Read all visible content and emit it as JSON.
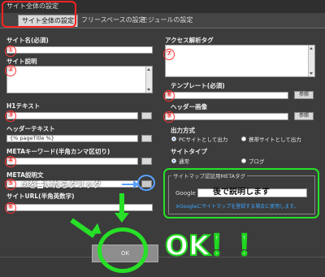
{
  "window": {
    "title": "サイト全体の設定"
  },
  "tabs": [
    {
      "label": "サイト全体の設定"
    },
    {
      "label": "フリースペースの設定"
    },
    {
      "label": "モジュールの設定"
    }
  ],
  "left": {
    "site_name_label": "サイト名(必須)",
    "site_desc_label": "サイト説明",
    "h1_label": "H1テキスト",
    "header_text_label": "ヘッダーテキスト",
    "header_text_value": "{% pageTitle %}",
    "meta_keywords_label": "METAキーワード(半角カンマ区切り)",
    "meta_desc_label": "META説明文",
    "site_url_label": "サイトURL(半角英数字)"
  },
  "right": {
    "access_tag_label": "アクセス解析タグ",
    "template_label": "テンプレート(必須)",
    "header_image_label": "ヘッダー画像",
    "ref_label": "参照",
    "output_label": "出力方式",
    "output_pc": "PCサイトとして出力",
    "output_mobile": "携帯サイトとして出力",
    "site_type_label": "サイトタイプ",
    "site_type_normal": "通常",
    "site_type_blog": "ブログ"
  },
  "sitemap": {
    "legend": "サイトマップ認証用METAタグ",
    "google_label": "Google",
    "note": "※Googleにサイトマップを登録する場合に使用します。"
  },
  "annotations": {
    "n1": "①",
    "n2": "②",
    "n3": "③",
    "n4": "④",
    "n5": "⑤",
    "n6": "⑥",
    "n7": "⑦",
    "n8": "⑧",
    "n9": "⑨",
    "write_then_click": "②を書いたらクリック",
    "explain_later": "後で説明します",
    "ok_big": "OK！！"
  },
  "footer": {
    "ok_label": "OK"
  },
  "colors": {
    "annotation_red": "#ff3333",
    "annotation_green": "#27e027"
  }
}
